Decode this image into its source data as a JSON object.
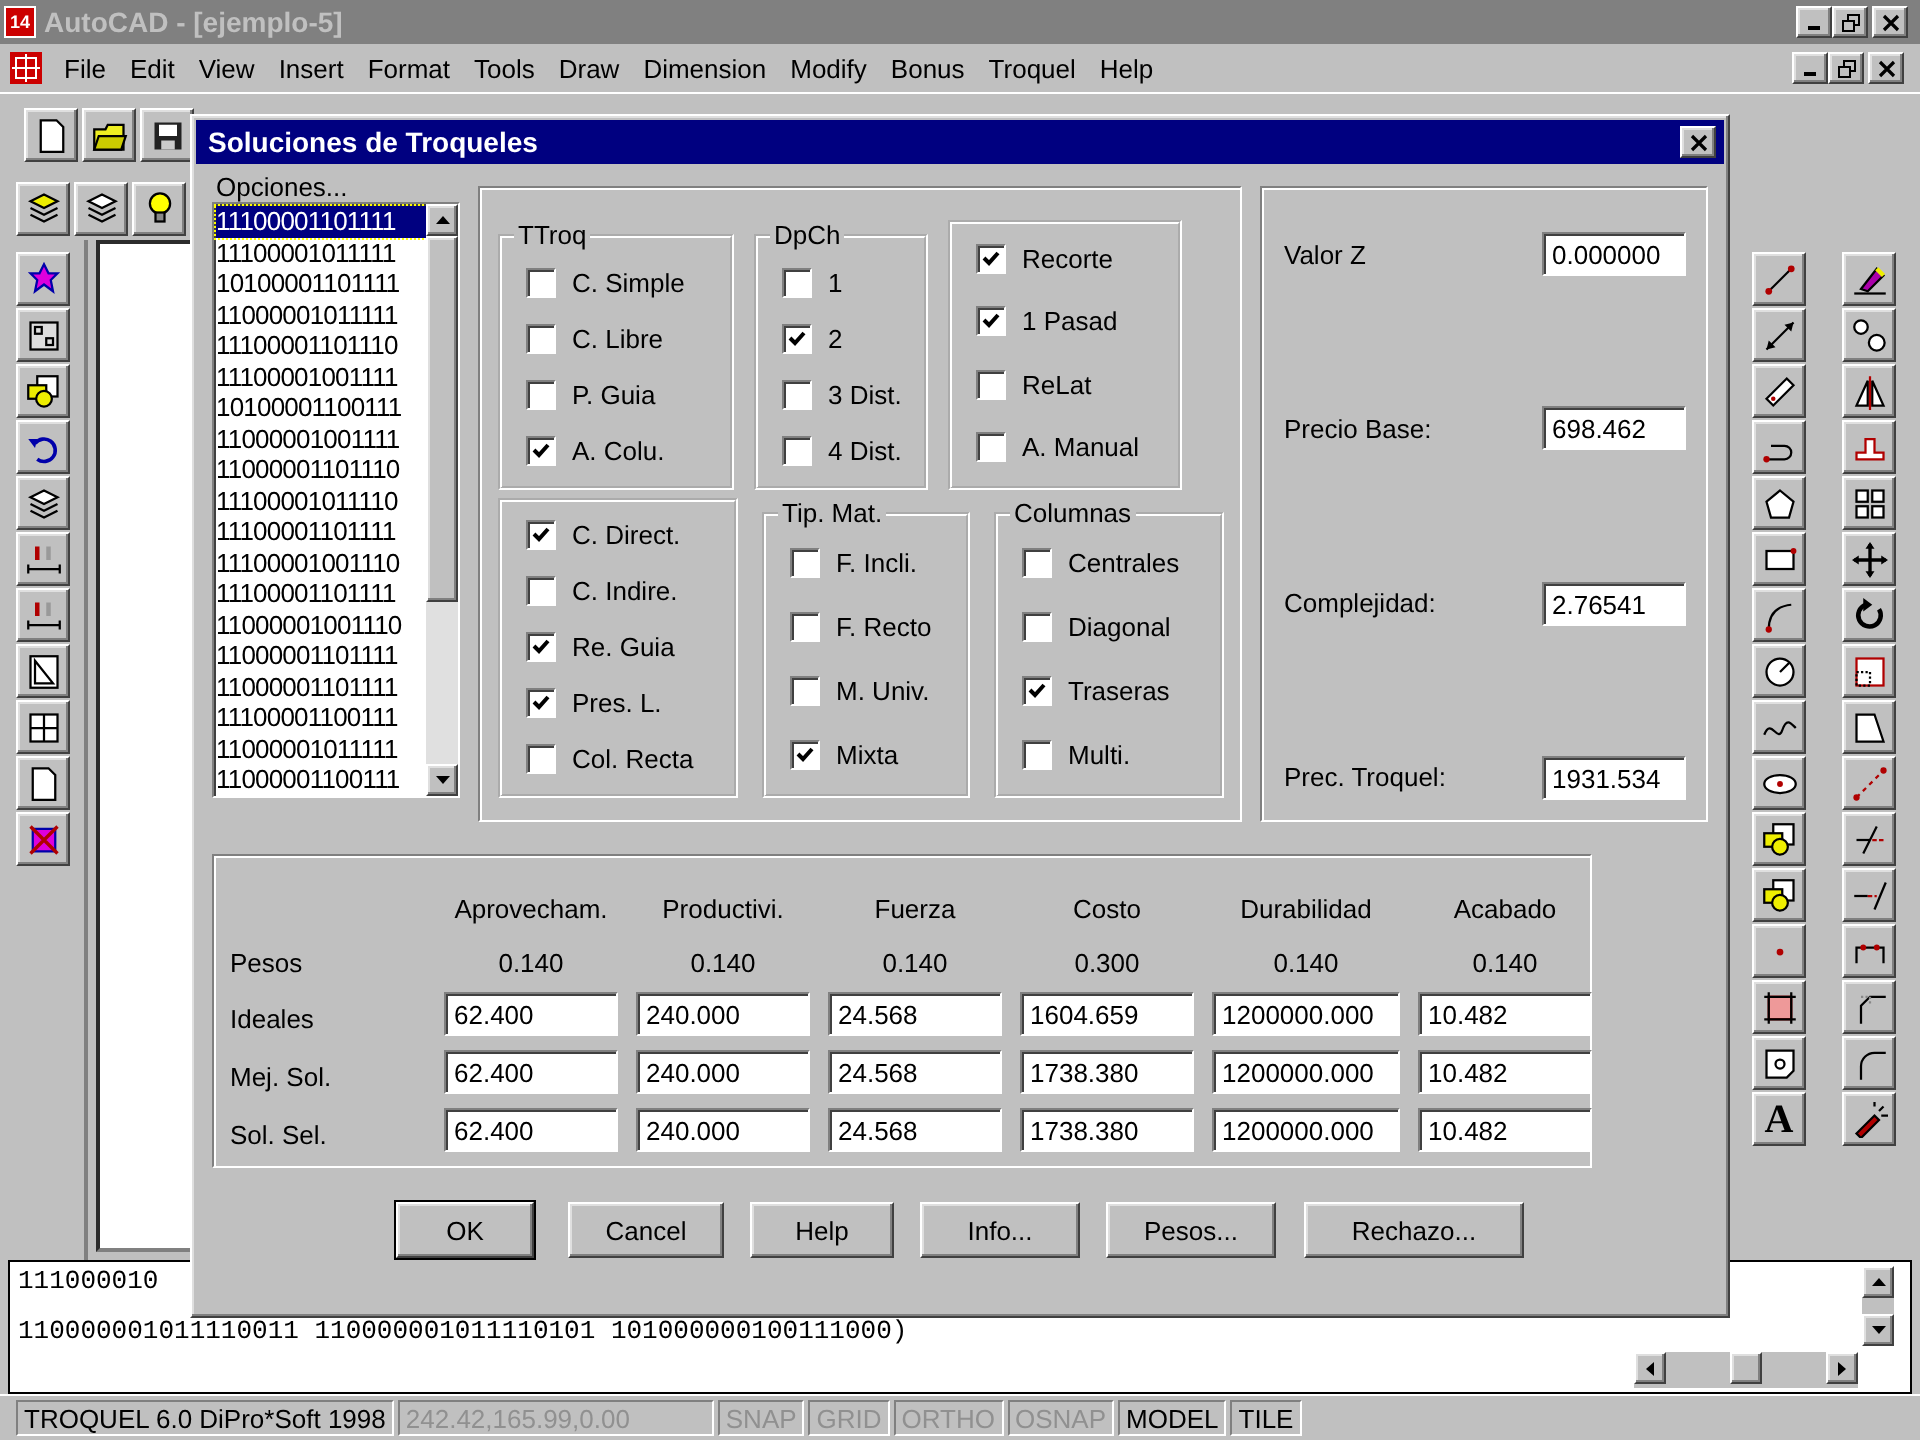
{
  "window": {
    "app_badge": "14",
    "title": "AutoCAD - [ejemplo-5]",
    "active": false
  },
  "menu": [
    "File",
    "Edit",
    "View",
    "Insert",
    "Format",
    "Tools",
    "Draw",
    "Dimension",
    "Modify",
    "Bonus",
    "Troquel",
    "Help"
  ],
  "text_tool_glyph": "A",
  "command_line": {
    "lines": [
      "111000010",
      "110000001011110011 110000001011110101 101000000100111000)"
    ]
  },
  "status_bar": [
    {
      "text": "TROQUEL 6.0 DiPro*Soft 1998",
      "kind": "label"
    },
    {
      "text": "242.42,165.99,0.00",
      "kind": "coords"
    },
    {
      "text": "SNAP",
      "kind": "toggle",
      "on": false
    },
    {
      "text": "GRID",
      "kind": "toggle",
      "on": false
    },
    {
      "text": "ORTHO",
      "kind": "toggle",
      "on": false
    },
    {
      "text": "OSNAP",
      "kind": "toggle",
      "on": false
    },
    {
      "text": "MODEL",
      "kind": "toggle",
      "on": true
    },
    {
      "text": "TILE",
      "kind": "toggle",
      "on": true
    }
  ],
  "dialog": {
    "title": "Soluciones de Troqueles",
    "list": {
      "label": "Opciones...",
      "items": [
        {
          "text": "11100001101111",
          "selected": true
        },
        {
          "text": "11100001011111",
          "selected": false
        },
        {
          "text": "10100001101111",
          "selected": false
        },
        {
          "text": "11000001011111",
          "selected": false
        },
        {
          "text": "11100001101110",
          "selected": false
        },
        {
          "text": "11100001001111",
          "selected": false
        },
        {
          "text": "10100001100111",
          "selected": false
        },
        {
          "text": "11000001001111",
          "selected": false
        },
        {
          "text": "11000001101110",
          "selected": false
        },
        {
          "text": "11100001011110",
          "selected": false
        },
        {
          "text": "11100001101111",
          "selected": false
        },
        {
          "text": "11100001001110",
          "selected": false
        },
        {
          "text": "11100001101111",
          "selected": false
        },
        {
          "text": "11000001001110",
          "selected": false
        },
        {
          "text": "11000001101111",
          "selected": false
        },
        {
          "text": "11000001101111",
          "selected": false
        },
        {
          "text": "11100001100111",
          "selected": false
        },
        {
          "text": "11000001011111",
          "selected": false
        },
        {
          "text": "11000001100111",
          "selected": false
        }
      ]
    },
    "groups": [
      {
        "title": "TTroq",
        "options": [
          {
            "label": "C. Simple",
            "checked": false
          },
          {
            "label": "C. Libre",
            "checked": false
          },
          {
            "label": "P. Guia",
            "checked": false
          },
          {
            "label": "A. Colu.",
            "checked": true
          }
        ]
      },
      {
        "title": "DpCh",
        "options": [
          {
            "label": "1",
            "checked": false
          },
          {
            "label": "2",
            "checked": true
          },
          {
            "label": "3 Dist.",
            "checked": false
          },
          {
            "label": "4 Dist.",
            "checked": false
          }
        ]
      },
      {
        "options": [
          {
            "label": "Recorte",
            "checked": true
          },
          {
            "label": "1 Pasad",
            "checked": true
          },
          {
            "label": "ReLat",
            "checked": false
          },
          {
            "label": "A. Manual",
            "checked": false
          }
        ]
      },
      {
        "options": [
          {
            "label": "C. Direct.",
            "checked": true
          },
          {
            "label": "C. Indire.",
            "checked": false
          },
          {
            "label": "Re. Guia",
            "checked": true
          },
          {
            "label": "Pres. L.",
            "checked": true
          },
          {
            "label": "Col. Recta",
            "checked": false
          }
        ]
      },
      {
        "title": "Tip. Mat.",
        "options": [
          {
            "label": "F. Incli.",
            "checked": false
          },
          {
            "label": "F. Recto",
            "checked": false
          },
          {
            "label": "M. Univ.",
            "checked": false
          },
          {
            "label": "Mixta",
            "checked": true
          }
        ]
      },
      {
        "title": "Columnas",
        "options": [
          {
            "label": "Centrales",
            "checked": false
          },
          {
            "label": "Diagonal",
            "checked": false
          },
          {
            "label": "Traseras",
            "checked": true
          },
          {
            "label": "Multi.",
            "checked": false
          }
        ]
      }
    ],
    "values": [
      {
        "label": "Valor Z",
        "value": "0.000000"
      },
      {
        "label": "Precio Base:",
        "value": "698.462"
      },
      {
        "label": "Complejidad:",
        "value": "2.76541"
      },
      {
        "label": "Prec. Troquel:",
        "value": "1931.534"
      }
    ],
    "weights_table": {
      "columns": [
        "Aprovecham.",
        "Productivi.",
        "Fuerza",
        "Costo",
        "Durabilidad",
        "Acabado"
      ],
      "rows": [
        {
          "label": "Pesos",
          "kind": "text",
          "cells": [
            "0.140",
            "0.140",
            "0.140",
            "0.300",
            "0.140",
            "0.140"
          ]
        },
        {
          "label": "Ideales",
          "kind": "field",
          "cells": [
            "62.400",
            "240.000",
            "24.568",
            "1604.659",
            "1200000.000",
            "10.482"
          ]
        },
        {
          "label": "Mej. Sol.",
          "kind": "field",
          "cells": [
            "62.400",
            "240.000",
            "24.568",
            "1738.380",
            "1200000.000",
            "10.482"
          ]
        },
        {
          "label": "Sol. Sel.",
          "kind": "field",
          "cells": [
            "62.400",
            "240.000",
            "24.568",
            "1738.380",
            "1200000.000",
            "10.482"
          ]
        }
      ]
    },
    "buttons": [
      {
        "label": "OK",
        "default": true
      },
      {
        "label": "Cancel",
        "default": false
      },
      {
        "label": "Help",
        "default": false
      },
      {
        "label": "Info...",
        "default": false
      },
      {
        "label": "Pesos...",
        "default": false
      },
      {
        "label": "Rechazo...",
        "default": false
      }
    ]
  }
}
